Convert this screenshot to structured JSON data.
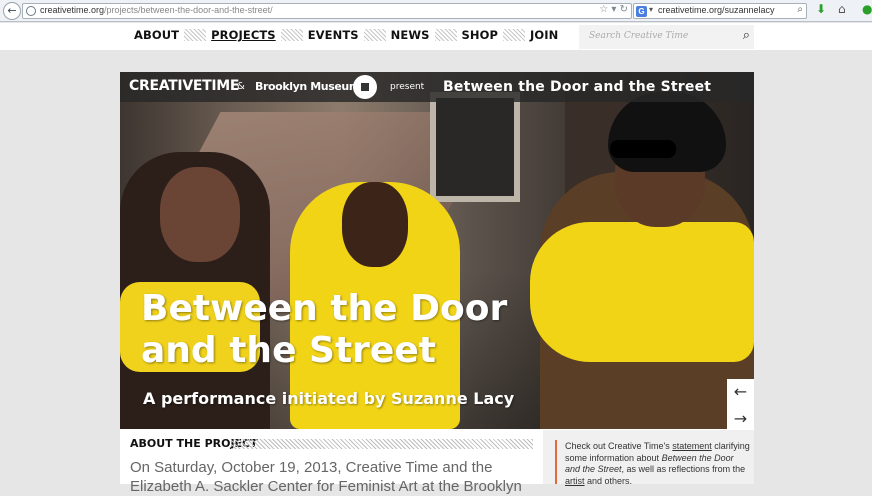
{
  "browser": {
    "url_domain": "creativetime.org",
    "url_path": "/projects/between-the-door-and-the-street/",
    "search_engine_letter": "G",
    "search_query": "creativetime.org/suzannelacy"
  },
  "nav": {
    "items": [
      {
        "label": "ABOUT",
        "active": false
      },
      {
        "label": "PROJECTS",
        "active": true
      },
      {
        "label": "EVENTS",
        "active": false
      },
      {
        "label": "NEWS",
        "active": false
      },
      {
        "label": "SHOP",
        "active": false
      },
      {
        "label": "JOIN",
        "active": false
      }
    ],
    "search_placeholder": "Search Creative Time"
  },
  "hero": {
    "brand": "CREATIVETIME",
    "amp": "&",
    "museum": "Brooklyn Museum",
    "present": "present",
    "bar_title": "Between the Door and the Street",
    "big_title_line1": "Between the Door",
    "big_title_line2": "and the Street",
    "subtitle": "A performance initiated by Suzanne Lacy"
  },
  "about": {
    "heading": "ABOUT THE PROJECT",
    "body": "On Saturday, October 19, 2013, Creative Time and the Elizabeth A. Sackler Center for Feminist Art at the Brooklyn"
  },
  "sidebar": {
    "t1": "Check out Creative Time's ",
    "link1": "statement",
    "t2": " clarifying some information about ",
    "em1": "Between the Door and the Street",
    "t3": ", as well as reflections from the ",
    "link2": "artist",
    "t4": " and others."
  },
  "colors": {
    "accent": "#e06a3b",
    "scarf_yellow": "#f2d417"
  }
}
